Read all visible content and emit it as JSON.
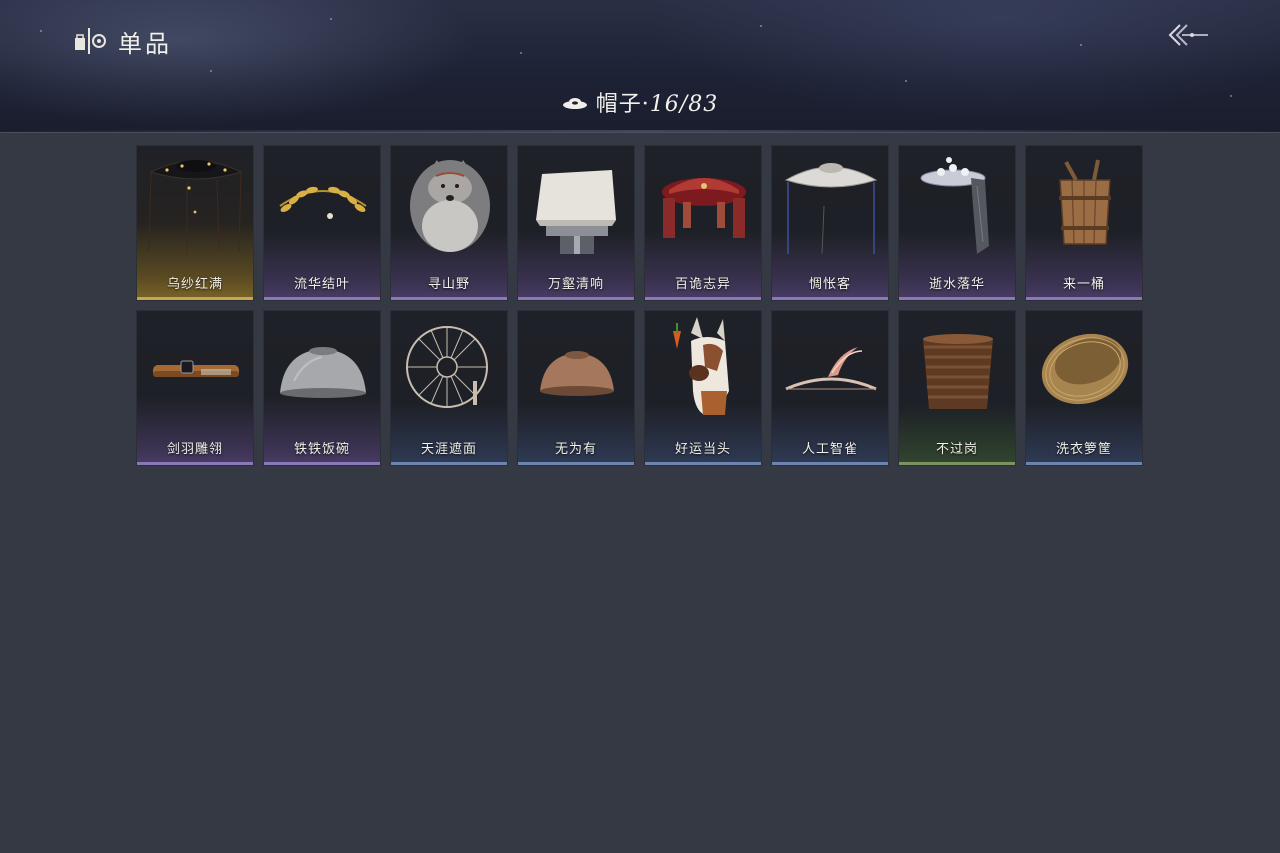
{
  "header": {
    "title": "单品",
    "menu_icon": "wardrobe-icon",
    "back_icon": "back-arrow-icon"
  },
  "category": {
    "icon": "hat-icon",
    "name": "帽子",
    "separator": "·",
    "count": "16/83"
  },
  "colors": {
    "background": "#353944",
    "header_bg": "#1d2134",
    "rarity_purple": "#8a78b8",
    "rarity_gold": "#c8a64a",
    "rarity_blue": "#6d84b0",
    "rarity_green": "#79945e"
  },
  "items": [
    {
      "label": "乌纱红满",
      "icon": "black-veil-hat-icon",
      "rarity": "gold"
    },
    {
      "label": "流华结叶",
      "icon": "golden-laurel-crown-icon",
      "rarity": "purple"
    },
    {
      "label": "寻山野",
      "icon": "wolf-head-hat-icon",
      "rarity": "purple"
    },
    {
      "label": "万壑清响",
      "icon": "paper-box-hat-icon",
      "rarity": "purple"
    },
    {
      "label": "百诡志异",
      "icon": "red-opera-hat-icon",
      "rarity": "purple"
    },
    {
      "label": "惆怅客",
      "icon": "white-bamboo-hat-icon",
      "rarity": "purple"
    },
    {
      "label": "逝水落华",
      "icon": "flower-veil-hat-icon",
      "rarity": "purple"
    },
    {
      "label": "来一桶",
      "icon": "wooden-bucket-hat-icon",
      "rarity": "purple"
    },
    {
      "label": "剑羽雕翎",
      "icon": "leather-headband-icon",
      "rarity": "purple"
    },
    {
      "label": "铁铁饭碗",
      "icon": "iron-bowl-hat-icon",
      "rarity": "purple"
    },
    {
      "label": "天涯遮面",
      "icon": "wire-lantern-hat-icon",
      "rarity": "blue"
    },
    {
      "label": "无为有",
      "icon": "clay-bowl-hat-icon",
      "rarity": "blue"
    },
    {
      "label": "好运当头",
      "icon": "donkey-head-hat-icon",
      "rarity": "blue"
    },
    {
      "label": "人工智雀",
      "icon": "bird-ornament-hat-icon",
      "rarity": "blue"
    },
    {
      "label": "不过岗",
      "icon": "stacked-bowls-hat-icon",
      "rarity": "green"
    },
    {
      "label": "洗衣箩筐",
      "icon": "wicker-basket-hat-icon",
      "rarity": "blue"
    }
  ]
}
